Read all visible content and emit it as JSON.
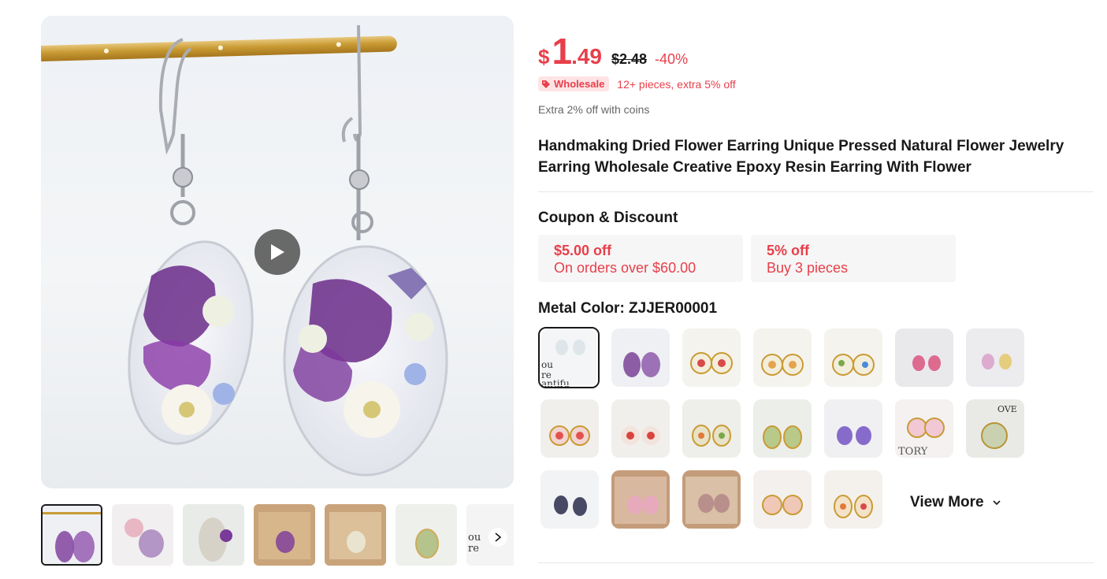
{
  "price": {
    "currency": "$",
    "integer": "1",
    "decimal": ".49",
    "original": "$2.48",
    "discount": "-40%",
    "color": "#e83f4a"
  },
  "wholesale": {
    "badge": "Wholesale",
    "text": "12+ pieces, extra 5% off",
    "icon": "tag-icon"
  },
  "coins_text": "Extra 2% off with coins",
  "title": "Handmaking Dried Flower Earring Unique Pressed Natural Flower Jewelry Earring Wholesale Creative Epoxy Resin Earring With Flower",
  "coupon_section": {
    "heading": "Coupon & Discount",
    "coupons": [
      {
        "amount": "$5.00 off",
        "condition": "On orders over $60.00"
      },
      {
        "amount": "5% off",
        "condition": "Buy 3 pieces"
      }
    ]
  },
  "metal_color": {
    "heading": "Metal Color: ZJJER00001",
    "swatch_count": 26,
    "selected_index": 0
  },
  "view_more": "View More",
  "gallery": {
    "thumbnail_count": 7,
    "active_index": 0,
    "icons": [
      "play-icon",
      "chevron-right-icon"
    ]
  },
  "colors": {
    "accent": "#e83f4a",
    "badge_bg": "#fde3e5",
    "text": "#191919",
    "muted": "#666666"
  }
}
